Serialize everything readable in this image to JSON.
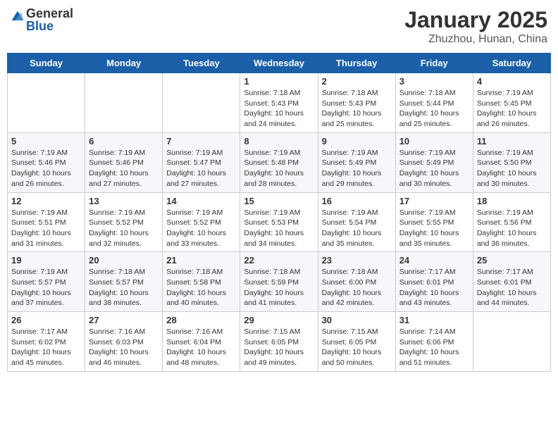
{
  "header": {
    "logo": {
      "general": "General",
      "blue": "Blue"
    },
    "title": "January 2025",
    "location": "Zhuzhou, Hunan, China"
  },
  "weekdays": [
    "Sunday",
    "Monday",
    "Tuesday",
    "Wednesday",
    "Thursday",
    "Friday",
    "Saturday"
  ],
  "weeks": [
    [
      {
        "day": "",
        "sunrise": "",
        "sunset": "",
        "daylight": ""
      },
      {
        "day": "",
        "sunrise": "",
        "sunset": "",
        "daylight": ""
      },
      {
        "day": "",
        "sunrise": "",
        "sunset": "",
        "daylight": ""
      },
      {
        "day": "1",
        "sunrise": "Sunrise: 7:18 AM",
        "sunset": "Sunset: 5:43 PM",
        "daylight": "Daylight: 10 hours and 24 minutes."
      },
      {
        "day": "2",
        "sunrise": "Sunrise: 7:18 AM",
        "sunset": "Sunset: 5:43 PM",
        "daylight": "Daylight: 10 hours and 25 minutes."
      },
      {
        "day": "3",
        "sunrise": "Sunrise: 7:18 AM",
        "sunset": "Sunset: 5:44 PM",
        "daylight": "Daylight: 10 hours and 25 minutes."
      },
      {
        "day": "4",
        "sunrise": "Sunrise: 7:19 AM",
        "sunset": "Sunset: 5:45 PM",
        "daylight": "Daylight: 10 hours and 26 minutes."
      }
    ],
    [
      {
        "day": "5",
        "sunrise": "Sunrise: 7:19 AM",
        "sunset": "Sunset: 5:46 PM",
        "daylight": "Daylight: 10 hours and 26 minutes."
      },
      {
        "day": "6",
        "sunrise": "Sunrise: 7:19 AM",
        "sunset": "Sunset: 5:46 PM",
        "daylight": "Daylight: 10 hours and 27 minutes."
      },
      {
        "day": "7",
        "sunrise": "Sunrise: 7:19 AM",
        "sunset": "Sunset: 5:47 PM",
        "daylight": "Daylight: 10 hours and 27 minutes."
      },
      {
        "day": "8",
        "sunrise": "Sunrise: 7:19 AM",
        "sunset": "Sunset: 5:48 PM",
        "daylight": "Daylight: 10 hours and 28 minutes."
      },
      {
        "day": "9",
        "sunrise": "Sunrise: 7:19 AM",
        "sunset": "Sunset: 5:49 PM",
        "daylight": "Daylight: 10 hours and 29 minutes."
      },
      {
        "day": "10",
        "sunrise": "Sunrise: 7:19 AM",
        "sunset": "Sunset: 5:49 PM",
        "daylight": "Daylight: 10 hours and 30 minutes."
      },
      {
        "day": "11",
        "sunrise": "Sunrise: 7:19 AM",
        "sunset": "Sunset: 5:50 PM",
        "daylight": "Daylight: 10 hours and 30 minutes."
      }
    ],
    [
      {
        "day": "12",
        "sunrise": "Sunrise: 7:19 AM",
        "sunset": "Sunset: 5:51 PM",
        "daylight": "Daylight: 10 hours and 31 minutes."
      },
      {
        "day": "13",
        "sunrise": "Sunrise: 7:19 AM",
        "sunset": "Sunset: 5:52 PM",
        "daylight": "Daylight: 10 hours and 32 minutes."
      },
      {
        "day": "14",
        "sunrise": "Sunrise: 7:19 AM",
        "sunset": "Sunset: 5:52 PM",
        "daylight": "Daylight: 10 hours and 33 minutes."
      },
      {
        "day": "15",
        "sunrise": "Sunrise: 7:19 AM",
        "sunset": "Sunset: 5:53 PM",
        "daylight": "Daylight: 10 hours and 34 minutes."
      },
      {
        "day": "16",
        "sunrise": "Sunrise: 7:19 AM",
        "sunset": "Sunset: 5:54 PM",
        "daylight": "Daylight: 10 hours and 35 minutes."
      },
      {
        "day": "17",
        "sunrise": "Sunrise: 7:19 AM",
        "sunset": "Sunset: 5:55 PM",
        "daylight": "Daylight: 10 hours and 35 minutes."
      },
      {
        "day": "18",
        "sunrise": "Sunrise: 7:19 AM",
        "sunset": "Sunset: 5:56 PM",
        "daylight": "Daylight: 10 hours and 36 minutes."
      }
    ],
    [
      {
        "day": "19",
        "sunrise": "Sunrise: 7:19 AM",
        "sunset": "Sunset: 5:57 PM",
        "daylight": "Daylight: 10 hours and 37 minutes."
      },
      {
        "day": "20",
        "sunrise": "Sunrise: 7:18 AM",
        "sunset": "Sunset: 5:57 PM",
        "daylight": "Daylight: 10 hours and 38 minutes."
      },
      {
        "day": "21",
        "sunrise": "Sunrise: 7:18 AM",
        "sunset": "Sunset: 5:58 PM",
        "daylight": "Daylight: 10 hours and 40 minutes."
      },
      {
        "day": "22",
        "sunrise": "Sunrise: 7:18 AM",
        "sunset": "Sunset: 5:59 PM",
        "daylight": "Daylight: 10 hours and 41 minutes."
      },
      {
        "day": "23",
        "sunrise": "Sunrise: 7:18 AM",
        "sunset": "Sunset: 6:00 PM",
        "daylight": "Daylight: 10 hours and 42 minutes."
      },
      {
        "day": "24",
        "sunrise": "Sunrise: 7:17 AM",
        "sunset": "Sunset: 6:01 PM",
        "daylight": "Daylight: 10 hours and 43 minutes."
      },
      {
        "day": "25",
        "sunrise": "Sunrise: 7:17 AM",
        "sunset": "Sunset: 6:01 PM",
        "daylight": "Daylight: 10 hours and 44 minutes."
      }
    ],
    [
      {
        "day": "26",
        "sunrise": "Sunrise: 7:17 AM",
        "sunset": "Sunset: 6:02 PM",
        "daylight": "Daylight: 10 hours and 45 minutes."
      },
      {
        "day": "27",
        "sunrise": "Sunrise: 7:16 AM",
        "sunset": "Sunset: 6:03 PM",
        "daylight": "Daylight: 10 hours and 46 minutes."
      },
      {
        "day": "28",
        "sunrise": "Sunrise: 7:16 AM",
        "sunset": "Sunset: 6:04 PM",
        "daylight": "Daylight: 10 hours and 48 minutes."
      },
      {
        "day": "29",
        "sunrise": "Sunrise: 7:15 AM",
        "sunset": "Sunset: 6:05 PM",
        "daylight": "Daylight: 10 hours and 49 minutes."
      },
      {
        "day": "30",
        "sunrise": "Sunrise: 7:15 AM",
        "sunset": "Sunset: 6:05 PM",
        "daylight": "Daylight: 10 hours and 50 minutes."
      },
      {
        "day": "31",
        "sunrise": "Sunrise: 7:14 AM",
        "sunset": "Sunset: 6:06 PM",
        "daylight": "Daylight: 10 hours and 51 minutes."
      },
      {
        "day": "",
        "sunrise": "",
        "sunset": "",
        "daylight": ""
      }
    ]
  ]
}
